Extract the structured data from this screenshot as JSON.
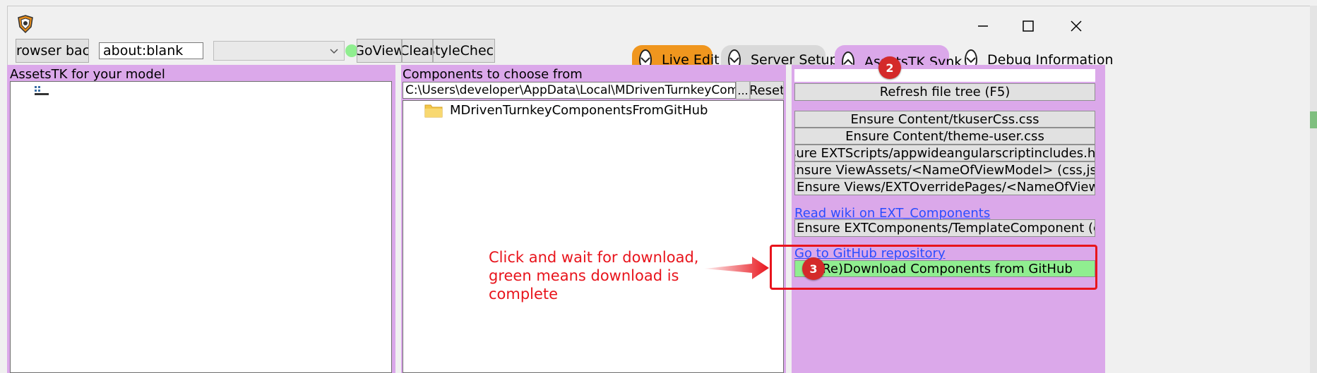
{
  "toolbar": {
    "browser_back": "Browser back",
    "url_value": "about:blank",
    "goview": "GoView",
    "clear": "Clear",
    "stylecheck": "StyleCheck"
  },
  "tabs": [
    {
      "label": "Live Edit",
      "color": "#f0961e",
      "active": false
    },
    {
      "label": "Server Setup",
      "color": "#d9d9d9",
      "active": false
    },
    {
      "label": "AssetsTK Synk",
      "color": "#dba8ea",
      "active": true
    },
    {
      "label": "Debug Information",
      "color": "#f0f0f0",
      "active": false
    }
  ],
  "left_panel": {
    "title": "AssetsTK for your model"
  },
  "middle_panel": {
    "title": "Components to choose from",
    "path_value": "C:\\Users\\developer\\AppData\\Local\\MDrivenTurnkeyComponents\\",
    "browse": "...",
    "reset": "Reset",
    "folder_item": "MDrivenTurnkeyComponentsFromGitHub"
  },
  "right_panel": {
    "refresh": "Refresh file tree (F5)",
    "ensure_buttons": [
      "Ensure Content/tkuserCss.css",
      "Ensure Content/theme-user.css",
      "Ensure EXTScripts/appwideangularscriptincludes.html",
      "Ensure ViewAssets/<NameOfViewModel> (css,js)",
      "Ensure Views/EXTOverridePages/<NameOfViewModel>.tagexpansion"
    ],
    "wiki_link": "Read wiki on EXT_Components",
    "ensure_component": "Ensure EXTComponents/TemplateComponent (css,html,js)",
    "github_link": "Go to GitHub repository",
    "download": "(Re)Download Components from GitHub"
  },
  "annotations": {
    "badge_2": "2",
    "badge_3": "3",
    "callout": "Click and wait for download, green means download is complete"
  },
  "colors": {
    "panel": "#dba8ea",
    "download_ok": "#90ee90",
    "status_dot": "#90ee90",
    "annotation": "#e8141c",
    "link": "#2a4dff"
  }
}
